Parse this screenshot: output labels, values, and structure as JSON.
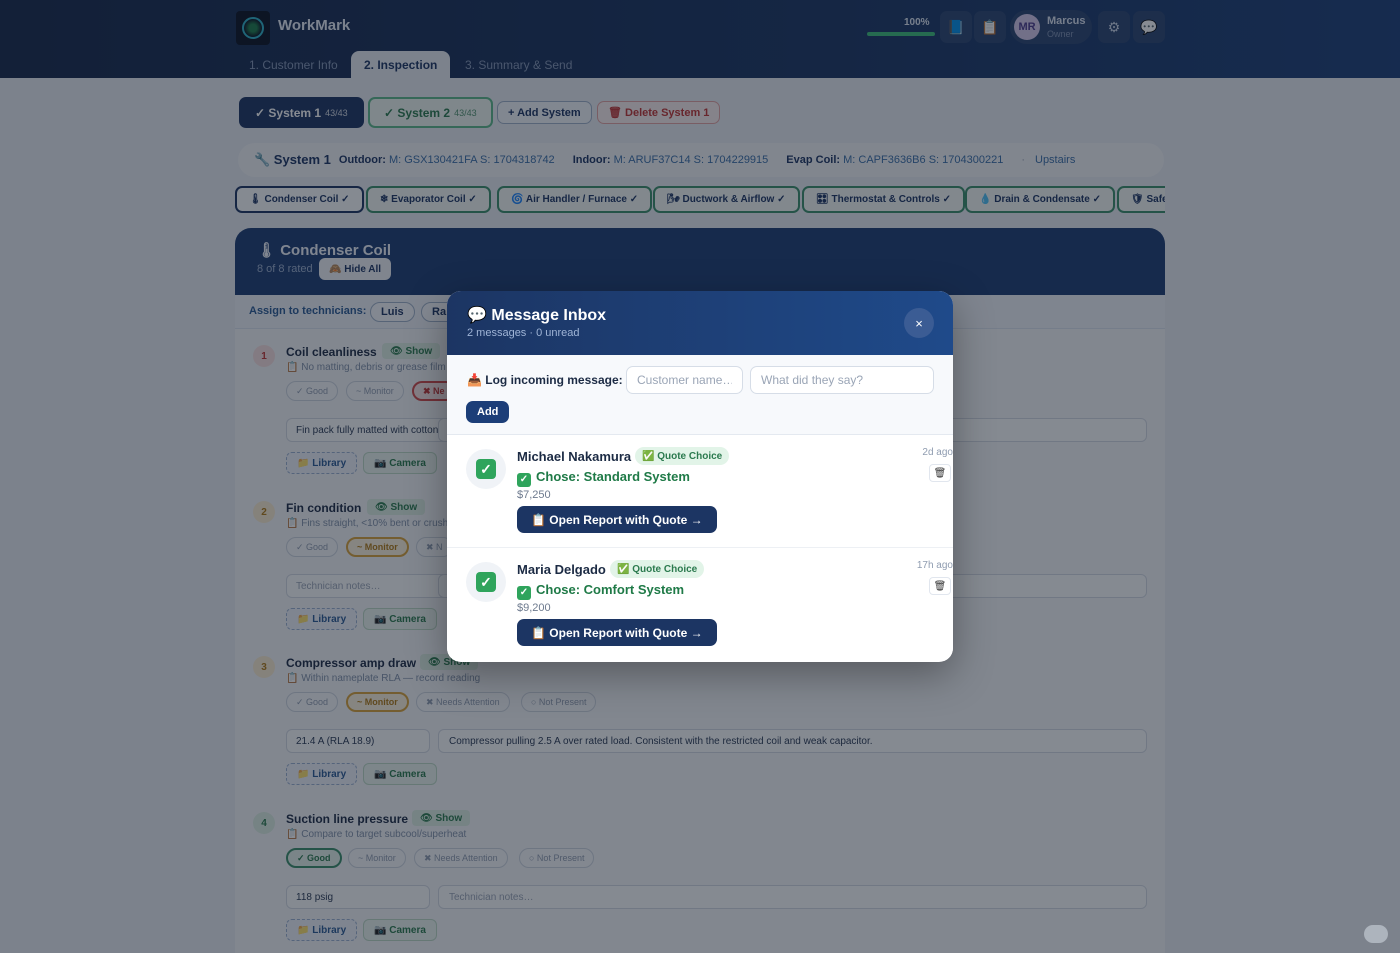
{
  "app": {
    "name": "WorkMark"
  },
  "header": {
    "progress_label": "100%",
    "progress_value": 1.0,
    "user": {
      "initials": "MR",
      "name": "Marcus",
      "role": "Owner"
    }
  },
  "steps": [
    "1. Customer Info",
    "2. Inspection",
    "3. Summary & Send"
  ],
  "systems": [
    {
      "label": "✓ System 1",
      "count": "43/43"
    },
    {
      "label": "✓ System 2",
      "count": "43/43"
    }
  ],
  "add_system": "+ Add System",
  "delete_system": "🗑 Delete System 1",
  "system_info": {
    "title": "🔧 System 1",
    "outdoor_label": "Outdoor:",
    "outdoor_value": "M: GSX130421FA S: 1704318742",
    "indoor_label": "Indoor:",
    "indoor_value": "M: ARUF37C14 S: 1704229915",
    "evap_label": "Evap Coil:",
    "evap_value": "M: CAPF3636B6 S: 1704300221",
    "location": "Upstairs"
  },
  "categories": [
    "🌡 Condenser Coil ✓",
    "❄ Evaporator Coil ✓",
    "🌀 Air Handler / Furnace ✓",
    "🌬 Ductwork & Airflow ✓",
    "🎛 Thermostat & Controls ✓",
    "💧 Drain & Condensate ✓",
    "🛡 Safety"
  ],
  "section": {
    "title": "🌡 Condenser Coil",
    "rated": "8 of 8 rated",
    "hide_all": "🙈 Hide All",
    "assign_label": "Assign to technicians:",
    "technicians": [
      "Luis",
      "Ra"
    ]
  },
  "ratings": [
    "✓ Good",
    "~ Monitor",
    "✖ Needs Attention",
    "○ Not Present"
  ],
  "items": [
    {
      "num": "1",
      "title": "Coil cleanliness",
      "show": "👁 Show",
      "desc": "📋 No matting, debris or grease film a",
      "reading": "Fin pack fully matted with cotton",
      "notes": "",
      "selected": "need",
      "rating_labels": [
        "✓ Good",
        "~ Monitor",
        "✖ Ne"
      ]
    },
    {
      "num": "2",
      "title": "Fin condition",
      "show": "👁 Show",
      "desc": "📋 Fins straight, <10% bent or crushe",
      "reading": "Technician notes…",
      "notes": "",
      "selected": "monitor",
      "rating_labels": [
        "✓ Good",
        "~ Monitor",
        "✖ N"
      ]
    },
    {
      "num": "3",
      "title": "Compressor amp draw",
      "show": "👁 Show",
      "desc": "📋 Within nameplate RLA — record reading",
      "reading": "21.4 A (RLA 18.9)",
      "notes": "Compressor pulling 2.5 A over rated load. Consistent with the restricted coil and weak capacitor.",
      "selected": "monitor",
      "rating_labels": [
        "✓ Good",
        "~ Monitor",
        "✖ Needs Attention",
        "○ Not Present"
      ]
    },
    {
      "num": "4",
      "title": "Suction line pressure",
      "show": "👁 Show",
      "desc": "📋 Compare to target subcool/superheat",
      "reading": "118 psig",
      "notes": "Technician notes…",
      "selected": "good",
      "rating_labels": [
        "✓ Good",
        "~ Monitor",
        "✖ Needs Attention",
        "○ Not Present"
      ]
    }
  ],
  "buttons": {
    "library": "📁 Library",
    "camera": "📷 Camera"
  },
  "modal": {
    "title": "💬 Message Inbox",
    "subtitle": "2 messages · 0 unread",
    "close": "×",
    "log_label": "📥 Log incoming message:",
    "name_placeholder": "Customer name…",
    "message_placeholder": "What did they say?",
    "add": "Add",
    "messages": [
      {
        "name": "Michael Nakamura",
        "badge": "✅ Quote Choice",
        "choice": "Chose: Standard System",
        "price": "$7,250",
        "open": "📋 Open Report with Quote →",
        "time": "2d ago"
      },
      {
        "name": "Maria Delgado",
        "badge": "✅ Quote Choice",
        "choice": "Chose: Comfort System",
        "price": "$9,200",
        "open": "📋 Open Report with Quote →",
        "time": "17h ago"
      }
    ]
  },
  "colors": {
    "navy": "#1c3563",
    "good": "#3a8e6a",
    "monitor": "#d9a33a",
    "needs": "#d24a4a"
  }
}
